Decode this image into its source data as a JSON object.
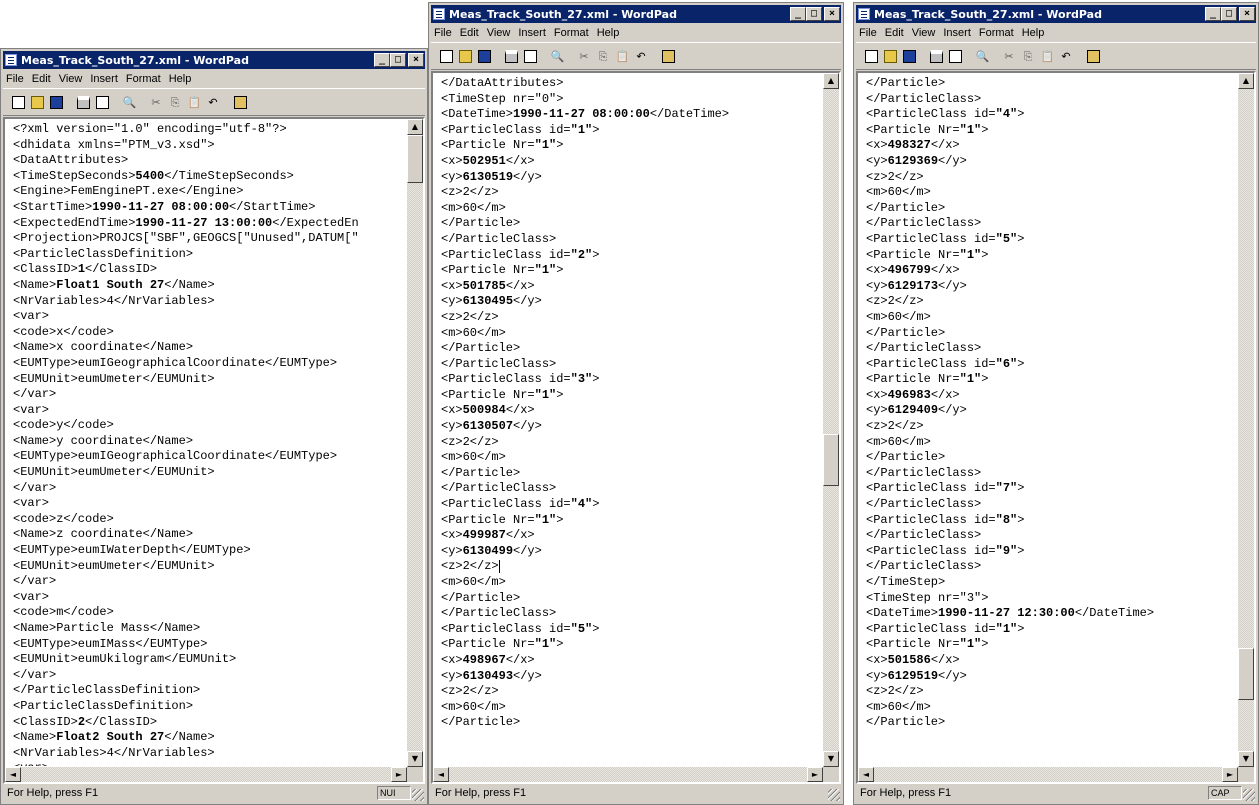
{
  "app": {
    "title": "Meas_Track_South_27.xml - WordPad",
    "menus": [
      "File",
      "Edit",
      "View",
      "Insert",
      "Format",
      "Help"
    ],
    "status": "For Help, press F1"
  },
  "toolbar_icons": [
    "new-icon",
    "open-icon",
    "save-icon",
    "print-icon",
    "print-preview-icon",
    "find-icon",
    "cut-icon",
    "copy-icon",
    "paste-icon",
    "undo-icon",
    "date-time-icon"
  ],
  "windows": [
    {
      "status_indicator": "NUI",
      "lines": [
        "<?xml version=\"1.0\" encoding=\"utf-8\"?>",
        "<dhidata xmlns=\"PTM_v3.xsd\">",
        "<DataAttributes>",
        "<TimeStepSeconds>**5400**</TimeStepSeconds>",
        "<Engine>FemEnginePT.exe</Engine>",
        "<StartTime>**1990-11-27 08:00:00**</StartTime>",
        "<ExpectedEndTime>**1990-11-27 13:00:00**</ExpectedEn",
        "<Projection>PROJCS[\"SBF\",GEOGCS[\"Unused\",DATUM[\"",
        "<ParticleClassDefinition>",
        "<ClassID>**1**</ClassID>",
        "<Name>**Float1 South 27**</Name>",
        "<NrVariables>4</NrVariables>",
        "<var>",
        "<code>x</code>",
        "<Name>x coordinate</Name>",
        "<EUMType>eumIGeographicalCoordinate</EUMType>",
        "<EUMUnit>eumUmeter</EUMUnit>",
        "</var>",
        "<var>",
        "<code>y</code>",
        "<Name>y coordinate</Name>",
        "<EUMType>eumIGeographicalCoordinate</EUMType>",
        "<EUMUnit>eumUmeter</EUMUnit>",
        "</var>",
        "<var>",
        "<code>z</code>",
        "<Name>z coordinate</Name>",
        "<EUMType>eumIWaterDepth</EUMType>",
        "<EUMUnit>eumUmeter</EUMUnit>",
        "</var>",
        "<var>",
        "<code>m</code>",
        "<Name>Particle Mass</Name>",
        "<EUMType>eumIMass</EUMType>",
        "<EUMUnit>eumUkilogram</EUMUnit>",
        "</var>",
        "</ParticleClassDefinition>",
        "<ParticleClassDefinition>",
        "<ClassID>**2**</ClassID>",
        "<Name>**Float2 South 27**</Name>",
        "<NrVariables>4</NrVariables>",
        "<var>"
      ]
    },
    {
      "status_indicator": "",
      "lines": [
        "</DataAttributes>",
        "<TimeStep nr=\"0\">",
        "<DateTime>**1990-11-27 08:00:00**</DateTime>",
        "<ParticleClass id=**\"1\"**>",
        "<Particle Nr=**\"1\"**>",
        "<x>**502951**</x>",
        "<y>**6130519**</y>",
        "<z>2</z>",
        "<m>60</m>",
        "</Particle>",
        "</ParticleClass>",
        "<ParticleClass id=**\"2\"**>",
        "<Particle Nr=**\"1\"**>",
        "<x>**501785**</x>",
        "<y>**6130495**</y>",
        "<z>2</z>",
        "<m>60</m>",
        "</Particle>",
        "</ParticleClass>",
        "<ParticleClass id=**\"3\"**>",
        "<Particle Nr=**\"1\"**>",
        "<x>**500984**</x>",
        "<y>**6130507**</y>",
        "<z>2</z>",
        "<m>60</m>",
        "</Particle>",
        "</ParticleClass>",
        "<ParticleClass id=**\"4\"**>",
        "<Particle Nr=**\"1\"**>",
        "<x>**499987**</x>",
        "<y>**6130499**</y>",
        "<z>2</z>|",
        "<m>60</m>",
        "</Particle>",
        "</ParticleClass>",
        "<ParticleClass id=**\"5\"**>",
        "<Particle Nr=**\"1\"**>",
        "<x>**498967**</x>",
        "<y>**6130493**</y>",
        "<z>2</z>",
        "<m>60</m>",
        "</Particle>"
      ]
    },
    {
      "status_indicator": "CAP",
      "lines": [
        "</Particle>",
        "</ParticleClass>",
        "<ParticleClass id=**\"4\"**>",
        "<Particle Nr=**\"1\"**>",
        "<x>**498327**</x>",
        "<y>**6129369**</y>",
        "<z>2</z>",
        "<m>60</m>",
        "</Particle>",
        "</ParticleClass>",
        "<ParticleClass id=**\"5\"**>",
        "<Particle Nr=**\"1\"**>",
        "<x>**496799**</x>",
        "<y>**6129173**</y>",
        "<z>2</z>",
        "<m>60</m>",
        "</Particle>",
        "</ParticleClass>",
        "<ParticleClass id=**\"6\"**>",
        "<Particle Nr=**\"1\"**>",
        "<x>**496983**</x>",
        "<y>**6129409**</y>",
        "<z>2</z>",
        "<m>60</m>",
        "</Particle>",
        "</ParticleClass>",
        "<ParticleClass id=**\"7\"**>",
        "</ParticleClass>",
        "<ParticleClass id=**\"8\"**>",
        "</ParticleClass>",
        "<ParticleClass id=**\"9\"**>",
        "</ParticleClass>",
        "</TimeStep>",
        "<TimeStep nr=\"3\">",
        "<DateTime>**1990-11-27 12:30:00**</DateTime>",
        "<ParticleClass id=**\"1\"**>",
        "<Particle Nr=**\"1\"**>",
        "<x>**501586**</x>",
        "<y>**6129519**</y>",
        "<z>2</z>",
        "<m>60</m>",
        "</Particle>"
      ]
    }
  ],
  "colors": {
    "titlebar": "#0a246a",
    "chrome": "#d4d0c8"
  }
}
